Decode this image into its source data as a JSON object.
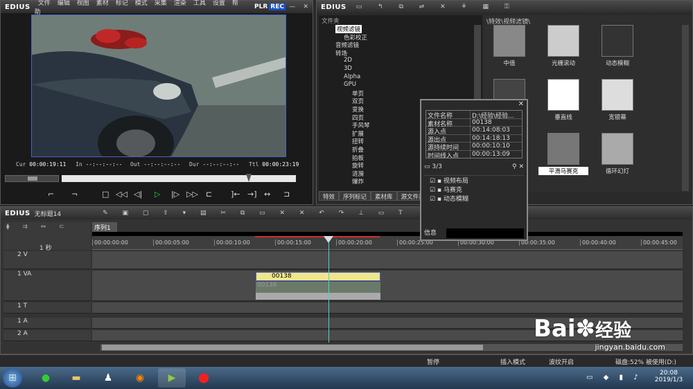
{
  "player": {
    "app": "EDIUS",
    "menu": [
      "文件",
      "编辑",
      "视图",
      "素材",
      "标记",
      "模式",
      "采集",
      "渲染",
      "工具",
      "设置",
      "帮助"
    ],
    "plr": "PLR",
    "rec": "REC",
    "cur_label": "Cur",
    "cur": "00:00:19:11",
    "in_label": "In",
    "in": "--:--:--:--",
    "out_label": "Out",
    "out": "--:--:--:--",
    "dur_label": "Dur",
    "dur": "--:--:--:--",
    "ttl_label": "Ttl",
    "ttl": "00:00:23:19"
  },
  "bin": {
    "app": "EDIUS",
    "tree_header": "文件夹",
    "tree_items": [
      {
        "label": "视频滤镜",
        "indent": 1
      },
      {
        "label": "色彩校正",
        "indent": 2
      },
      {
        "label": "音频滤镜",
        "indent": 1
      },
      {
        "label": "转场",
        "indent": 1
      },
      {
        "label": "2D",
        "indent": 2
      },
      {
        "label": "3D",
        "indent": 2
      },
      {
        "label": "Alpha",
        "indent": 2
      },
      {
        "label": "GPU",
        "indent": 2
      },
      {
        "label": "单页",
        "indent": 3
      },
      {
        "label": "双页",
        "indent": 3
      },
      {
        "label": "变换",
        "indent": 3
      },
      {
        "label": "四页",
        "indent": 3
      },
      {
        "label": "手风琴",
        "indent": 3
      },
      {
        "label": "扩展",
        "indent": 3
      },
      {
        "label": "扭转",
        "indent": 3
      },
      {
        "label": "折叠",
        "indent": 3
      },
      {
        "label": "拍板",
        "indent": 3
      },
      {
        "label": "旋转",
        "indent": 3
      },
      {
        "label": "涟漪",
        "indent": 3
      },
      {
        "label": "爆炸",
        "indent": 3
      }
    ],
    "path": "\\特效\\视频滤镜\\",
    "effects": [
      {
        "label": "中值"
      },
      {
        "label": "光栅滚动"
      },
      {
        "label": "动态模糊"
      },
      {
        "label": ""
      },
      {
        "label": "垂直线"
      },
      {
        "label": "宽银幕"
      },
      {
        "label": ""
      },
      {
        "label": "平滑马赛克"
      },
      {
        "label": "循环幻灯"
      }
    ],
    "tabs": [
      "特效",
      "序列标记",
      "素材库",
      "源文件浏"
    ]
  },
  "info": {
    "rows": [
      {
        "k": "文件名称",
        "v": "D:\\经验\\经验..."
      },
      {
        "k": "素材名称",
        "v": "00138"
      },
      {
        "k": "源入点",
        "v": "00:14:08:03"
      },
      {
        "k": "源出点",
        "v": "00:14:18:13"
      },
      {
        "k": "源持续时间",
        "v": "00:00:10:10"
      },
      {
        "k": "时间线入点",
        "v": "00:00:13:09"
      }
    ],
    "count": "3/3",
    "effects": [
      "视频布局",
      "马赛克",
      "动态模糊"
    ],
    "footer": "信息"
  },
  "timeline": {
    "app": "EDIUS",
    "project": "无标题14",
    "sequence_tab": "序列1",
    "scale": "1 秒",
    "ruler": [
      "00:00:00:00",
      "00:00:05:00",
      "00:00:10:00",
      "00:00:15:00",
      "00:00:20:00",
      "00:00:25:00",
      "00:00:30:00",
      "00:00:35:00",
      "00:00:40:00",
      "00:00:45:00"
    ],
    "tracks": [
      "2 V",
      "1 VA",
      "1 T",
      "1 A",
      "2 A"
    ],
    "clip_name": "00138",
    "clip_audio": "00138"
  },
  "status": {
    "s1": "暂停",
    "s2": "插入模式",
    "s3": "波纹开启",
    "s4": "磁盘:52% 被使用(D:)"
  },
  "taskbar": {
    "time": "20:08",
    "date": "2019/1/3"
  },
  "watermark": {
    "brand": "Bai",
    "brand2": "经验",
    "url": "jingyan.baidu.com"
  }
}
